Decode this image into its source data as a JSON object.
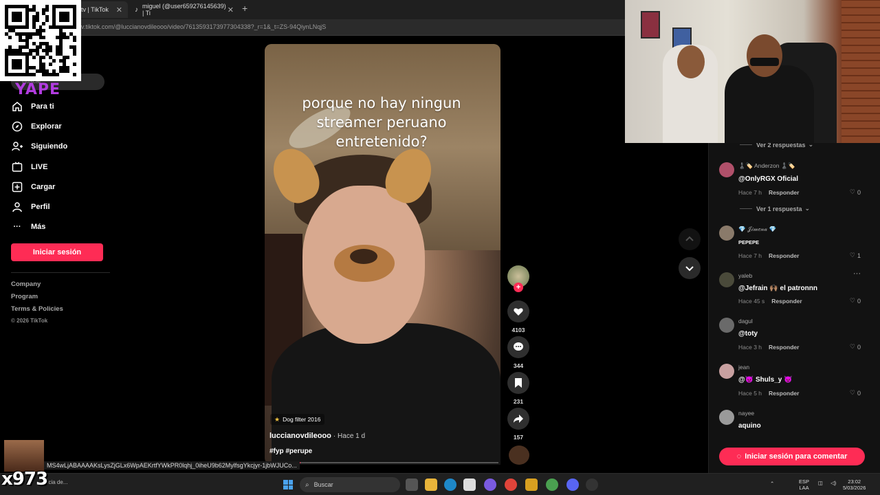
{
  "browser": {
    "tabs": [
      {
        "label": "tv | TikTok"
      },
      {
        "label": "miguel (@user659276145639) | Ti"
      }
    ],
    "url": "v.tiktok.com/@luccianovdileooo/video/7613593173977304338?_r=1&_t=ZS-94QiynLNqjS"
  },
  "sidebar": {
    "search_placeholder": "Buscar",
    "overlay_text": "YAPE",
    "nav": [
      {
        "label": "Para ti",
        "icon": "home-icon"
      },
      {
        "label": "Explorar",
        "icon": "compass-icon"
      },
      {
        "label": "Siguiendo",
        "icon": "following-icon"
      },
      {
        "label": "LIVE",
        "icon": "live-icon"
      },
      {
        "label": "Cargar",
        "icon": "upload-icon"
      },
      {
        "label": "Perfil",
        "icon": "profile-icon"
      },
      {
        "label": "Más",
        "icon": "more-icon"
      }
    ],
    "login_label": "Iniciar sesión",
    "footer": [
      "Company",
      "Program",
      "Terms & Policies"
    ],
    "copyright": "© 2026 TikTok"
  },
  "video": {
    "caption": "porque no hay ningun streamer peruano entretenido?",
    "effect": "Dog filter 2016",
    "author": "luccianovdileooo",
    "time": "· Hace 1 d",
    "tags": "#fyp #perupe",
    "progress": 0.04
  },
  "actions": {
    "likes": "4103",
    "comments": "344",
    "saves": "231",
    "shares": "157"
  },
  "comments": {
    "replies_top": "Ver 2 respuestas",
    "items": [
      {
        "user": "♟️🏷️ Anderzon ♟️🏷️",
        "text": "@OnlyRGX Oficial",
        "time": "Hace 7 h",
        "reply": "Responder",
        "likes": "0",
        "avatar_color": "#b0506a"
      },
      {
        "user": "💎 𝒥𝒾𝓂𝑒𝓃𝒶 💎",
        "text": "PEPEPE",
        "time": "Hace 7 h",
        "reply": "Responder",
        "likes": "1",
        "avatar_color": "#8a7a6a"
      },
      {
        "user": "yaleb",
        "text": "@Jefrain 🙌🏽 el patronnn",
        "time": "Hace 45 s",
        "reply": "Responder",
        "likes": "0",
        "avatar_color": "#4a4a3a"
      },
      {
        "user": "dagul",
        "text": "@toty",
        "time": "Hace 3 h",
        "reply": "Responder",
        "likes": "0",
        "avatar_color": "#6a6a6a"
      },
      {
        "user": "jean",
        "text": "@👿 Shuls_y 👿",
        "time": "Hace 5 h",
        "reply": "Responder",
        "likes": "0",
        "avatar_color": "#c8a0a0"
      },
      {
        "user": "nayee",
        "text": "aquino",
        "time": "",
        "reply": "",
        "likes": "",
        "avatar_color": "#9a9a9a"
      }
    ],
    "replies_mid": "Ver 1 respuesta",
    "login_comment": "Iniciar sesión para comentar"
  },
  "overlay": {
    "channel": "x973",
    "status_url": "MS4wLjABAAAAKsLysZjGLx6WpAEKrtfYWkPR0lqhj_0iheU9b62MylfsgYkcjyr-1jbWJUCo...",
    "taskbar_app_text": "ncia de..."
  },
  "taskbar": {
    "search": "Buscar",
    "lang": "ESP",
    "lang2": "LAA",
    "time": "23:02",
    "date": "5/03/2026"
  }
}
